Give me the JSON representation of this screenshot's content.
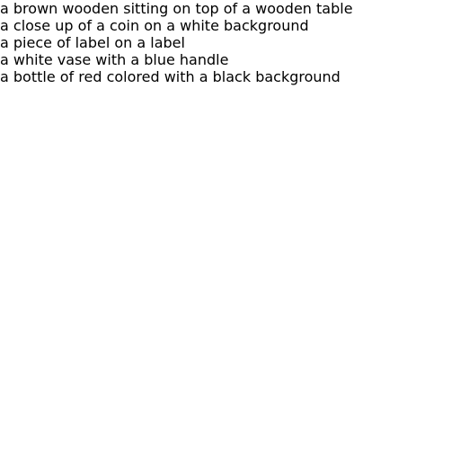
{
  "captions": [
    "a brown wooden sitting on top of a wooden table",
    "a close up of a coin on a white background",
    "a piece of label on a label",
    "a white vase with a blue handle",
    "a bottle of red colored with a black background"
  ]
}
